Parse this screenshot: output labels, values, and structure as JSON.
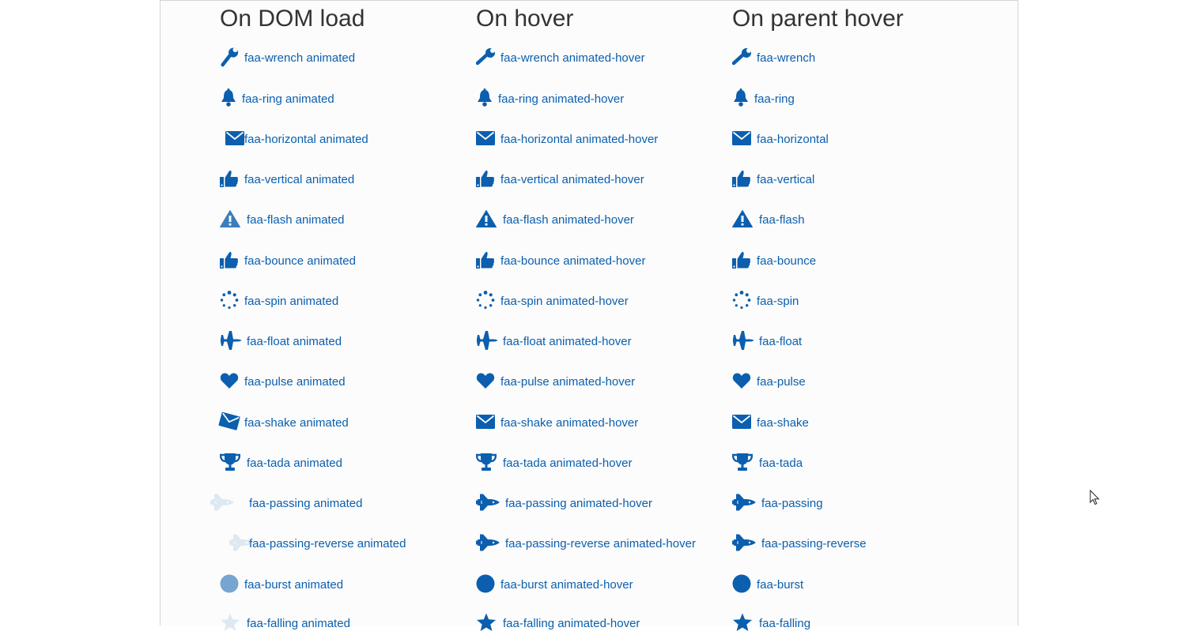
{
  "columns": [
    {
      "title": "On DOM load",
      "items": [
        {
          "icon": "wrench-icon",
          "label": "faa-wrench animated"
        },
        {
          "icon": "bell-icon",
          "label": "faa-ring animated"
        },
        {
          "icon": "envelope-icon",
          "label": "faa-horizontal animated"
        },
        {
          "icon": "thumbs-up-icon",
          "label": "faa-vertical animated"
        },
        {
          "icon": "warning-icon",
          "label": "faa-flash animated"
        },
        {
          "icon": "thumbs-up-icon",
          "label": "faa-bounce animated"
        },
        {
          "icon": "spinner-icon",
          "label": "faa-spin animated"
        },
        {
          "icon": "plane-icon",
          "label": "faa-float animated"
        },
        {
          "icon": "heart-icon",
          "label": "faa-pulse animated"
        },
        {
          "icon": "envelope-icon",
          "label": "faa-shake animated"
        },
        {
          "icon": "trophy-icon",
          "label": "faa-tada animated"
        },
        {
          "icon": "space-shuttle-icon",
          "label": "faa-passing animated"
        },
        {
          "icon": "space-shuttle-icon",
          "label": "faa-passing-reverse animated"
        },
        {
          "icon": "circle-icon",
          "label": "faa-burst animated"
        },
        {
          "icon": "star-icon",
          "label": "faa-falling animated"
        }
      ]
    },
    {
      "title": "On hover",
      "items": [
        {
          "icon": "wrench-icon",
          "label": "faa-wrench animated-hover"
        },
        {
          "icon": "bell-icon",
          "label": "faa-ring animated-hover"
        },
        {
          "icon": "envelope-icon",
          "label": "faa-horizontal animated-hover"
        },
        {
          "icon": "thumbs-up-icon",
          "label": "faa-vertical animated-hover"
        },
        {
          "icon": "warning-icon",
          "label": "faa-flash animated-hover"
        },
        {
          "icon": "thumbs-up-icon",
          "label": "faa-bounce animated-hover"
        },
        {
          "icon": "spinner-icon",
          "label": "faa-spin animated-hover"
        },
        {
          "icon": "plane-icon",
          "label": "faa-float animated-hover"
        },
        {
          "icon": "heart-icon",
          "label": "faa-pulse animated-hover"
        },
        {
          "icon": "envelope-icon",
          "label": "faa-shake animated-hover"
        },
        {
          "icon": "trophy-icon",
          "label": "faa-tada animated-hover"
        },
        {
          "icon": "space-shuttle-icon",
          "label": "faa-passing animated-hover"
        },
        {
          "icon": "space-shuttle-icon",
          "label": "faa-passing-reverse animated-hover"
        },
        {
          "icon": "circle-icon",
          "label": "faa-burst animated-hover"
        },
        {
          "icon": "star-icon",
          "label": "faa-falling animated-hover"
        }
      ]
    },
    {
      "title": "On parent hover",
      "items": [
        {
          "icon": "wrench-icon",
          "label": "faa-wrench"
        },
        {
          "icon": "bell-icon",
          "label": "faa-ring"
        },
        {
          "icon": "envelope-icon",
          "label": "faa-horizontal"
        },
        {
          "icon": "thumbs-up-icon",
          "label": "faa-vertical"
        },
        {
          "icon": "warning-icon",
          "label": "faa-flash"
        },
        {
          "icon": "thumbs-up-icon",
          "label": "faa-bounce"
        },
        {
          "icon": "spinner-icon",
          "label": "faa-spin"
        },
        {
          "icon": "plane-icon",
          "label": "faa-float"
        },
        {
          "icon": "heart-icon",
          "label": "faa-pulse"
        },
        {
          "icon": "envelope-icon",
          "label": "faa-shake"
        },
        {
          "icon": "trophy-icon",
          "label": "faa-tada"
        },
        {
          "icon": "space-shuttle-icon",
          "label": "faa-passing"
        },
        {
          "icon": "space-shuttle-icon",
          "label": "faa-passing-reverse"
        },
        {
          "icon": "circle-icon",
          "label": "faa-burst"
        },
        {
          "icon": "star-icon",
          "label": "faa-falling"
        }
      ]
    }
  ],
  "colors": {
    "icon": "#0b5fae",
    "link": "#0b5fae",
    "heading": "#333333"
  }
}
